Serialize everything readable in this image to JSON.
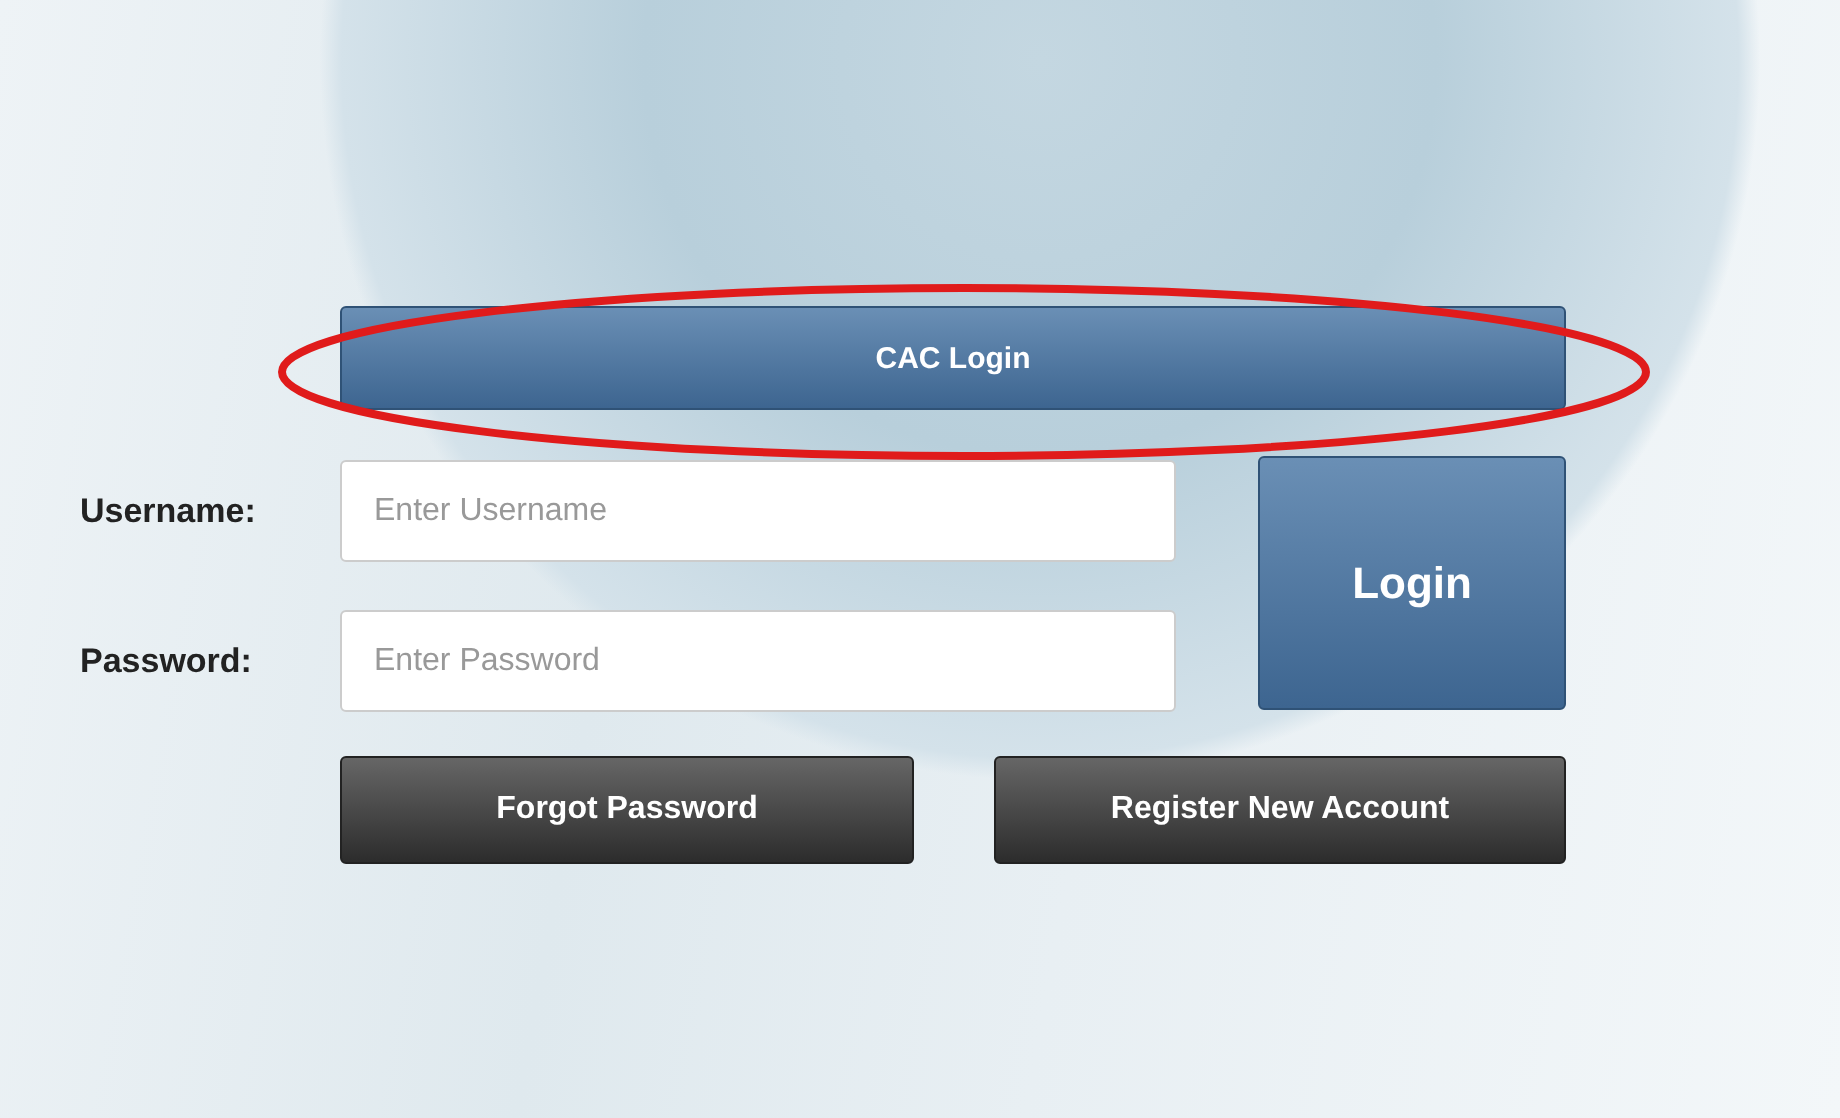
{
  "cac_button": "CAC Login",
  "fields": [
    {
      "label": "Username:",
      "placeholder": "Enter Username"
    },
    {
      "label": "Password:",
      "placeholder": "Enter Password"
    }
  ],
  "login_button": "Login",
  "buttons": [
    "Forgot Password",
    "Register New Account"
  ]
}
